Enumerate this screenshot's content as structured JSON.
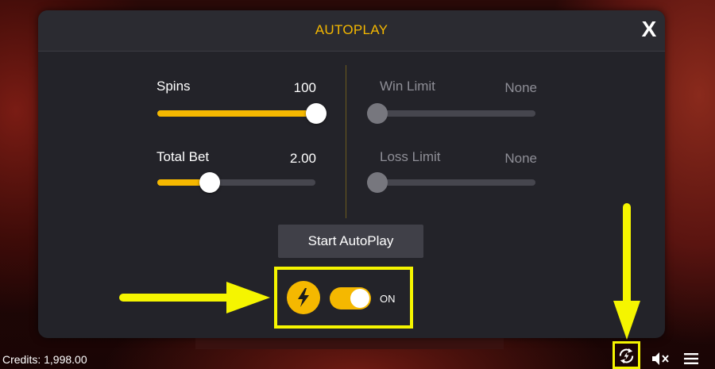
{
  "dialog": {
    "title": "AUTOPLAY",
    "close_label": "X"
  },
  "settings": {
    "spins": {
      "label": "Spins",
      "value": "100",
      "level": 1.0
    },
    "total_bet": {
      "label": "Total Bet",
      "value": "2.00",
      "level": 0.33
    },
    "win_limit": {
      "label": "Win Limit",
      "value": "None",
      "level": 0.0
    },
    "loss_limit": {
      "label": "Loss Limit",
      "value": "None",
      "level": 0.0
    }
  },
  "start_button": {
    "label": "Start AutoPlay"
  },
  "turbo": {
    "icon": "lightning-bolt-icon",
    "state_label": "ON",
    "on": true
  },
  "footer": {
    "credits": "Credits: 1,998.00"
  },
  "toolbar": {
    "icons": [
      "autoplay-icon",
      "mute-speaker-icon",
      "menu-icon"
    ]
  },
  "colors": {
    "accent": "#f5b800",
    "highlight": "#f5f500",
    "panel": "#232329"
  }
}
